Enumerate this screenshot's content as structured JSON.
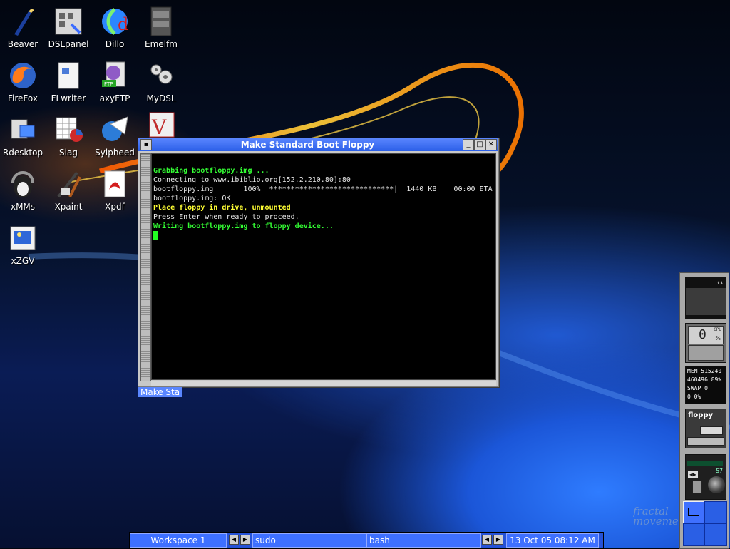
{
  "desktop": {
    "icons": [
      {
        "label": "Beaver",
        "name": "beaver-icon"
      },
      {
        "label": "DSLpanel",
        "name": "dslpanel-icon"
      },
      {
        "label": "Dillo",
        "name": "dillo-icon"
      },
      {
        "label": "Emelfm",
        "name": "emelfm-icon"
      },
      {
        "label": "FireFox",
        "name": "firefox-icon"
      },
      {
        "label": "FLwriter",
        "name": "flwriter-icon"
      },
      {
        "label": "axyFTP",
        "name": "axyftp-icon"
      },
      {
        "label": "MyDSL",
        "name": "mydsl-icon"
      },
      {
        "label": "Rdesktop",
        "name": "rdesktop-icon"
      },
      {
        "label": "Siag",
        "name": "siag-icon"
      },
      {
        "label": "Sylpheed",
        "name": "sylpheed-icon"
      },
      {
        "label": "xMMs",
        "name": "xmms-icon"
      },
      {
        "label": "Xpaint",
        "name": "xpaint-icon"
      },
      {
        "label": "Xpdf",
        "name": "xpdf-icon"
      },
      {
        "label": "xZGV",
        "name": "xzgv-icon"
      }
    ]
  },
  "window": {
    "title": "Make Standard Boot Floppy",
    "menu_glyph": "▪",
    "minimize_glyph": "_",
    "maximize_glyph": "□",
    "close_glyph": "✕",
    "terminal_lines": [
      "Grabbing bootfloppy.img ...",
      "Connecting to www.ibiblio.org[152.2.210.80]:80",
      "bootfloppy.img       100% |*****************************|  1440 KB    00:00 ETA",
      "bootfloppy.img: OK",
      "Place floppy in drive, unmounted",
      "Press Enter when ready to proceed.",
      "Writing bootfloppy.img to floppy device..."
    ],
    "taskbar_label": "Make Sta"
  },
  "taskbar": {
    "workspace": "Workspace 1",
    "task1": "sudo",
    "task2": "bash",
    "clock": "13 Oct 05 08:12 AM"
  },
  "dock": {
    "cpu_label": "CPU",
    "cpu_value": "0",
    "cpu_unit": "%",
    "mem_label": "MEM",
    "mem_value": "515240",
    "mem_used": "460496",
    "mem_pct": "89%",
    "swap_label": "SWAP",
    "swap_value": "0",
    "swap_used": "0",
    "swap_pct": "0%",
    "floppy_label": "floppy",
    "volume_value": "57"
  },
  "brand": "fractal movement"
}
